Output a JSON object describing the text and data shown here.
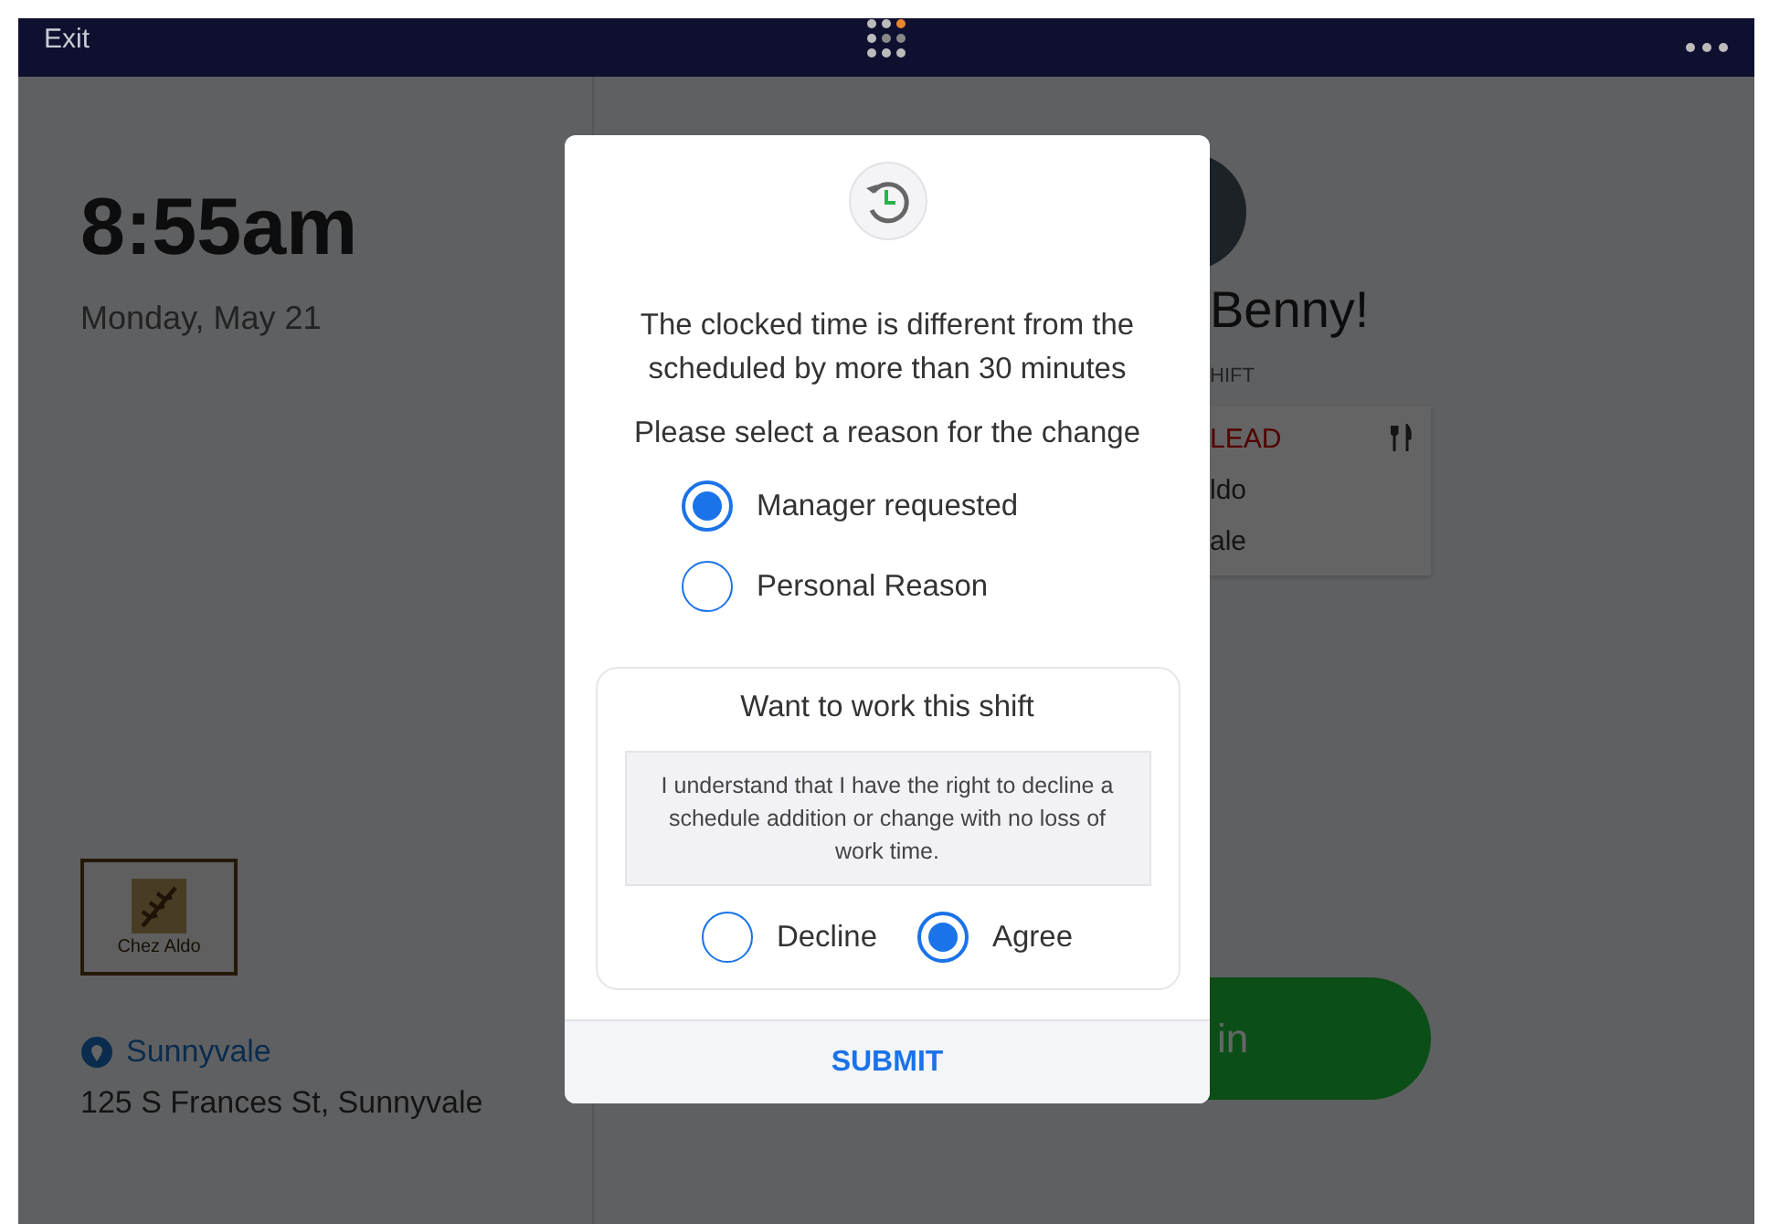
{
  "top_bar": {
    "exit": "Exit"
  },
  "left_panel": {
    "time": "8:55am",
    "date": "Monday, May 21",
    "logo_text": "Chez Aldo",
    "location": "Sunnyvale",
    "address": "125 S Frances St, Sunnyvale"
  },
  "right_panel": {
    "greeting": "Benny!",
    "section_label": "HIFT",
    "shift_card": {
      "role": "LEAD",
      "line_2": "ldo",
      "line_3": "ale"
    },
    "clock_button": "in"
  },
  "dialog": {
    "message": "The clocked time is different from the scheduled by more than 30 minutes",
    "prompt": "Please select a reason for the change",
    "reasons": [
      {
        "label": "Manager requested",
        "selected": true
      },
      {
        "label": "Personal Reason",
        "selected": false
      }
    ],
    "consent": {
      "title": "Want to work this shift",
      "notice": "I understand that I have the right to decline a schedule addition or change with no loss of work time.",
      "options": [
        {
          "label": "Decline",
          "selected": false
        },
        {
          "label": "Agree",
          "selected": true
        }
      ]
    },
    "submit": "SUBMIT"
  }
}
